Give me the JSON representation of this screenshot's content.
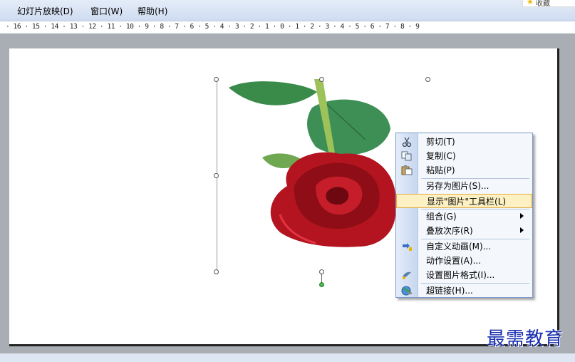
{
  "menubar": {
    "items": [
      {
        "label": "幻灯片放映(D)"
      },
      {
        "label": "窗口(W)"
      },
      {
        "label": "帮助(H)"
      }
    ]
  },
  "favorite": {
    "label": "收藏",
    "icon": "star-icon",
    "color": "#f0b400"
  },
  "ruler": {
    "text": "· 16 · 15 · 14 · 13 · 12 · 11 · 10 · 9 · 8 · 7 · 6 · 5 · 4 · 3 · 2 · 1 · 0 · 1 · 2 · 3 · 4 · 5 · 6 · 7 · 8 · 9"
  },
  "context_menu": {
    "items": [
      {
        "label": "剪切(T)",
        "icon": "scissors-icon"
      },
      {
        "label": "复制(C)",
        "icon": "copy-icon"
      },
      {
        "label": "粘贴(P)",
        "icon": "paste-icon"
      },
      {
        "label": "另存为图片(S)..."
      },
      {
        "label": "显示\"图片\"工具栏(L)",
        "highlighted": true
      },
      {
        "label": "组合(G)",
        "submenu": true
      },
      {
        "label": "叠放次序(R)",
        "submenu": true
      },
      {
        "label": "自定义动画(M)...",
        "icon": "animation-icon"
      },
      {
        "label": "动作设置(A)..."
      },
      {
        "label": "设置图片格式(I)...",
        "icon": "format-picture-icon"
      },
      {
        "label": "超链接(H)...",
        "icon": "hyperlink-icon"
      }
    ]
  },
  "watermark": {
    "text": "最需教育",
    "color": "#1a2fb0"
  },
  "colors": {
    "highlight_bg": "#fdf0c2",
    "highlight_border": "#e3a944",
    "menubar": "#cfdcf0",
    "workspace": "#a9aeb5"
  }
}
